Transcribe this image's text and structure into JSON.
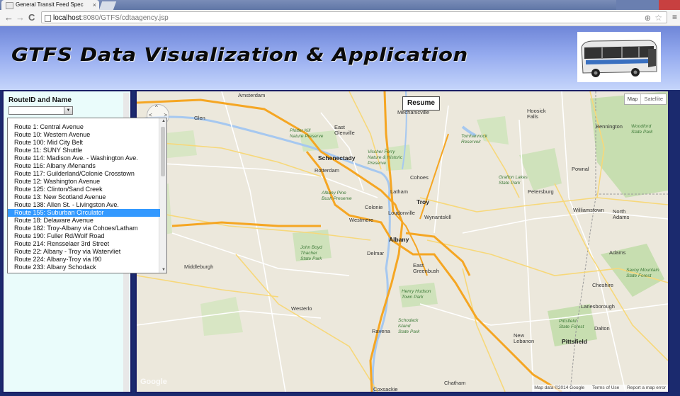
{
  "browser": {
    "tab_title": "General Transit Feed Spec",
    "tab_close": "×",
    "url_host": "localhost",
    "url_rest": ":8080/GTFS/cdtaagency.jsp",
    "back": "←",
    "forward": "→",
    "reload": "C"
  },
  "header": {
    "title": "GTFS Data Visualization & Application"
  },
  "sidebar": {
    "route_label": "RouteID and Name",
    "select_value": ""
  },
  "dropdown": {
    "selected_index": 11,
    "options": [
      "Route 1: Central Avenue",
      "Route 10: Western Avenue",
      "Route 100: Mid City Belt",
      "Route 11: SUNY Shuttle",
      "Route 114: Madison Ave. - Washington Ave.",
      "Route 116: Albany /Menands",
      "Route 117: Guilderland/Colonie Crosstown",
      "Route 12: Washington Avenue",
      "Route 125: Clinton/Sand Creek",
      "Route 13: New Scotland Avenue",
      "Route 138: Allen St. - Livingston Ave.",
      "Route 155: Suburban Circulator",
      "Route 18: Delaware Avenue",
      "Route 182: Troy-Albany via Cohoes/Latham",
      "Route 190: Fuller Rd/Wolf Road",
      "Route 214: Rensselaer 3rd Street",
      "Route 22: Albany - Troy via Watervliet",
      "Route 224: Albany-Troy via I90",
      "Route 233: Albany Schodack"
    ]
  },
  "map": {
    "resume_label": "Resume",
    "map_type_map": "Map",
    "map_type_satellite": "Satellite",
    "attribution": [
      "Map data ©2014 Google",
      "Terms of Use",
      "Report a map error"
    ],
    "labels": {
      "amsterdam": "Amsterdam",
      "mechanicville": "Mechanicville",
      "hoosick_falls": "Hoosick\nFalls",
      "glen": "Glen",
      "plotter_kill": "Plotter Kill\nNature Preserve",
      "east_glenville": "East\nGlenville",
      "tomhannock": "Tomhannock\nReservoir",
      "bennington": "Bennington",
      "woodford": "Woodford\nState Park",
      "schenectady": "Schenectady",
      "vischer_ferry": "Vischer Ferry\nNature & Historic\nPreserve",
      "rotterdam": "Rotterdam",
      "cohoes": "Cohoes",
      "grafton": "Grafton Lakes\nState Park",
      "pownal": "Pownal",
      "albany_pine": "Albany Pine\nBush Preserve",
      "latham": "Latham",
      "troy": "Troy",
      "petersburg": "Petersburg",
      "colonie": "Colonie",
      "loudonville": "Loudonville",
      "williamstown": "Williamstown",
      "north_adams": "North\nAdams",
      "westmere": "Westmere",
      "wynantskill": "Wynantskill",
      "albany": "Albany",
      "john_boyd": "John Boyd\nThacher\nState Park",
      "delmar": "Delmar",
      "east_greenbush": "East\nGreenbush",
      "adams": "Adams",
      "middleburgh": "Middleburgh",
      "savoy": "Savoy Mountain\nState Forest",
      "henry_hudson": "Henry Hudson\nTown Park",
      "cheshire": "Cheshire",
      "westerlo": "Westerlo",
      "lanesborough": "Lanesborough",
      "schodack": "Schodack\nIsland\nState Park",
      "pittsfield_sf": "Pittsfield\nState Forest",
      "ravena": "Ravena",
      "new_lebanon": "New\nLebanon",
      "dalton": "Dalton",
      "pittsfield": "Pittsfield",
      "chatham": "Chatham",
      "coxsackie": "Coxsackie",
      "google": "Google"
    }
  },
  "colors": {
    "panel_border": "#1a1f66",
    "sidebar_bg": "#eafcfb",
    "selected_option": "#3399ff",
    "map_bg": "#ece8dc",
    "highway": "#f5a623"
  }
}
